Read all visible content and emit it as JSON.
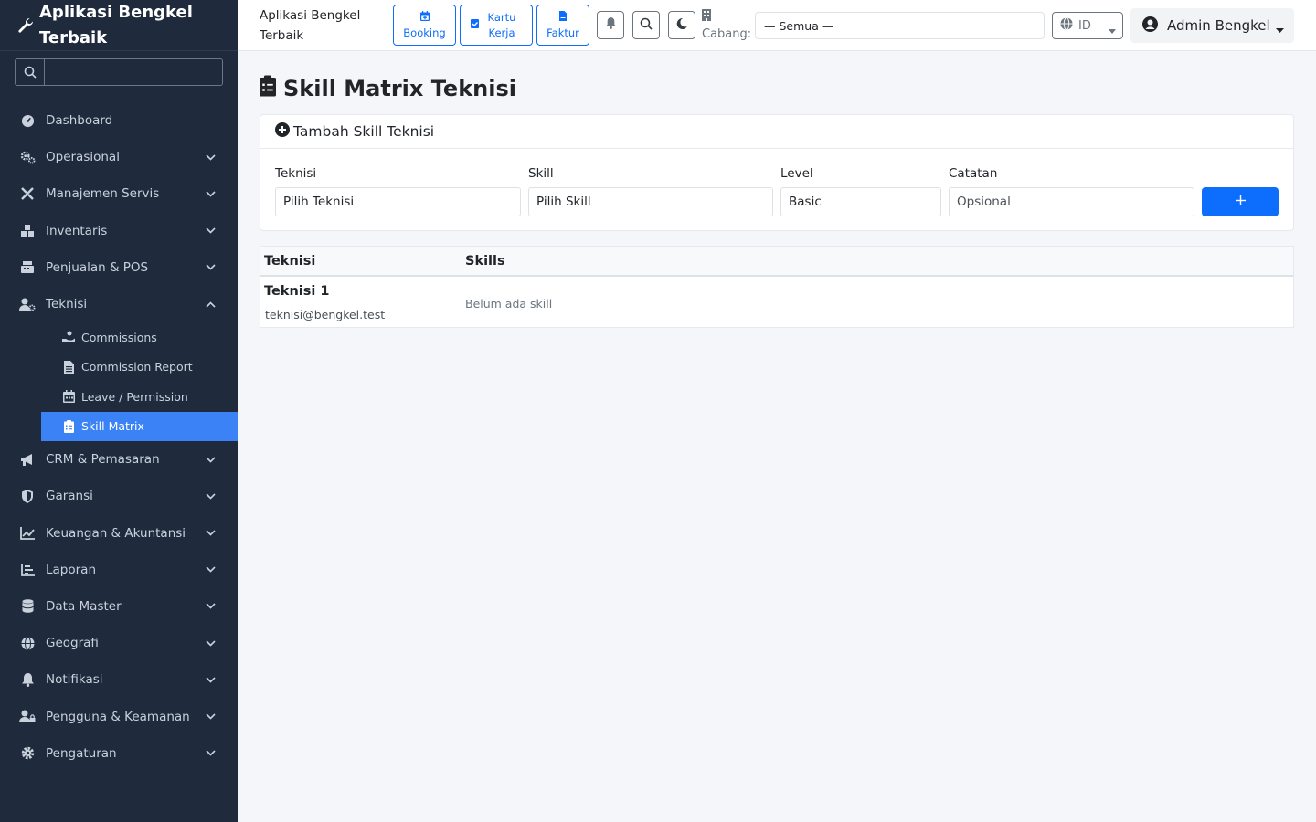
{
  "sidebar": {
    "brand": "Aplikasi Bengkel Terbaik",
    "search_placeholder": "",
    "items": [
      {
        "label": "Dashboard"
      },
      {
        "label": "Operasional"
      },
      {
        "label": "Manajemen Servis"
      },
      {
        "label": "Inventaris"
      },
      {
        "label": "Penjualan & POS"
      },
      {
        "label": "Teknisi"
      },
      {
        "label": "CRM & Pemasaran"
      },
      {
        "label": "Garansi"
      },
      {
        "label": "Keuangan & Akuntansi"
      },
      {
        "label": "Laporan"
      },
      {
        "label": "Data Master"
      },
      {
        "label": "Geografi"
      },
      {
        "label": "Notifikasi"
      },
      {
        "label": "Pengguna & Keamanan"
      },
      {
        "label": "Pengaturan"
      }
    ],
    "teknisi_sub": [
      {
        "label": "Commissions"
      },
      {
        "label": "Commission Report"
      },
      {
        "label": "Leave / Permission"
      },
      {
        "label": "Skill Matrix"
      }
    ]
  },
  "topbar": {
    "title": "Aplikasi Bengkel Terbaik",
    "booking": "Booking",
    "kartu_kerja": "Kartu Kerja",
    "faktur": "Faktur",
    "branch_label": "Cabang:",
    "branch_value": "— Semua —",
    "lang_value": "ID",
    "user_name": "Admin Bengkel"
  },
  "page": {
    "title": "Skill Matrix Teknisi",
    "card_title": "Tambah Skill Teknisi",
    "form": {
      "teknisi_label": "Teknisi",
      "teknisi_value": "Pilih Teknisi",
      "skill_label": "Skill",
      "skill_value": "Pilih Skill",
      "level_label": "Level",
      "level_value": "Basic",
      "catatan_label": "Catatan",
      "catatan_placeholder": "Opsional"
    },
    "table": {
      "headers": [
        "Teknisi",
        "Skills"
      ],
      "rows": [
        {
          "name": "Teknisi 1",
          "email": "teknisi@bengkel.test",
          "skills": "Belum ada skill"
        }
      ]
    }
  },
  "colors": {
    "sidebar_bg": "#1f2a3c",
    "accent": "#0d6efd",
    "active_item": "#3b82f6"
  }
}
